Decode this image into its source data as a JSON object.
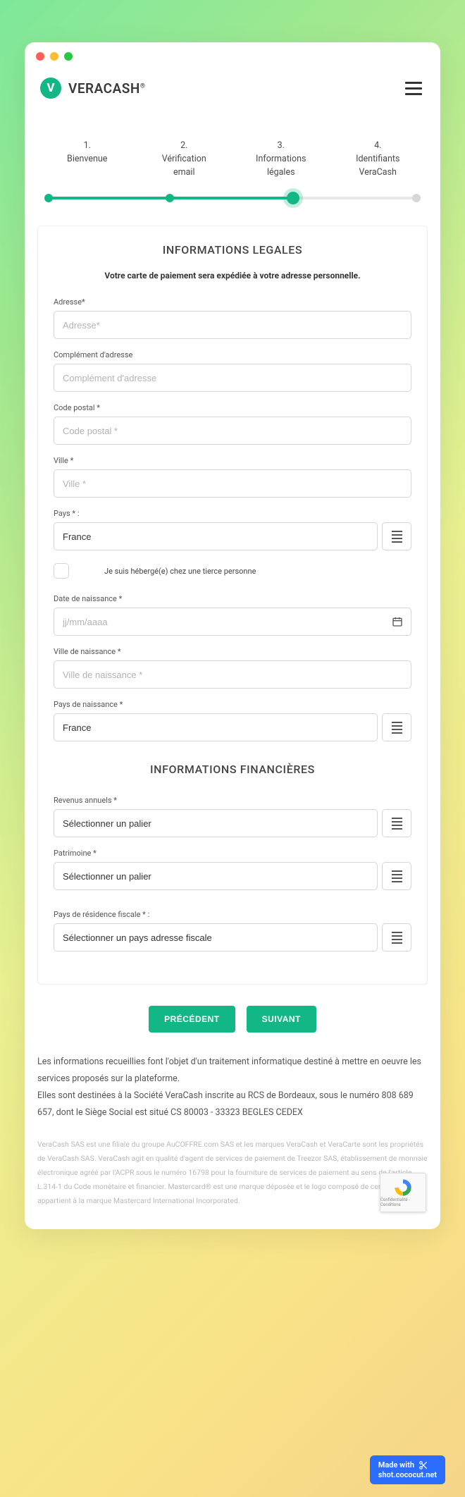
{
  "brand": {
    "name": "VERACASH"
  },
  "steps": [
    {
      "num": "1.",
      "label": "Bienvenue"
    },
    {
      "num": "2.",
      "label_l1": "Vérification",
      "label_l2": "email"
    },
    {
      "num": "3.",
      "label_l1": "Informations",
      "label_l2": "légales"
    },
    {
      "num": "4.",
      "label_l1": "Identifiants",
      "label_l2": "VeraCash"
    }
  ],
  "section1_title": "INFORMATIONS LEGALES",
  "notice": "Votre carte de paiement sera expédiée à votre adresse personnelle.",
  "fields": {
    "adresse": {
      "label": "Adresse*",
      "placeholder": "Adresse*"
    },
    "complement": {
      "label": "Complément d'adresse",
      "placeholder": "Complément d'adresse"
    },
    "cp": {
      "label": "Code postal *",
      "placeholder": "Code postal *"
    },
    "ville": {
      "label": "Ville *",
      "placeholder": "Ville *"
    },
    "pays": {
      "label": "Pays * :",
      "value": "France"
    },
    "heberge": {
      "label": "Je suis hébergé(e) chez une tierce personne"
    },
    "dob": {
      "label": "Date de naissance *",
      "placeholder": "jj/mm/aaaa"
    },
    "ville_naiss": {
      "label": "Ville de naissance *",
      "placeholder": "Ville de naissance *"
    },
    "pays_naiss": {
      "label": "Pays de naissance *",
      "value": "France"
    }
  },
  "section2_title": "INFORMATIONS FINANCIÈRES",
  "fin": {
    "revenus": {
      "label": "Revenus annuels *",
      "value": "Sélectionner un palier"
    },
    "patrimoine": {
      "label": "Patrimoine *",
      "value": "Sélectionner un palier"
    },
    "residence": {
      "label": "Pays de résidence fiscale * :",
      "value": "Sélectionner un pays adresse fiscale"
    }
  },
  "buttons": {
    "prev": "PRÉCÉDENT",
    "next": "SUIVANT"
  },
  "info_p1": "Les informations recueillies font l'objet d'un traitement informatique destiné à mettre en oeuvre les services proposés sur la plateforme.",
  "info_p2": "Elles sont destinées à la Société VeraCash inscrite au RCS de Bordeaux, sous le numéro 808 689 657, dont le Siège Social est situé CS 80003 - 33323 BEGLES CEDEX",
  "legal": "VeraCash SAS est une filiale du groupe AuCOFFRE.com SAS et les marques VeraCash et VeraCarte sont les propriétés de VeraCash SAS. VeraCash agit en qualité d'agent de services de paiement de Treezor SAS, établissement de monnaie électronique agréé par l'ACPR sous le numéro 16798 pour la fourniture de services de paiement au sens de l'article L.314-1 du Code monétaire et financier. Mastercard® est une marque déposée et le logo composé de cercles appartient à la marque Mastercard International Incorporated.",
  "recaptcha": "Confidentialité - Conditions",
  "madewith": {
    "l1": "Made with",
    "l2": "shot.cococut.net"
  }
}
